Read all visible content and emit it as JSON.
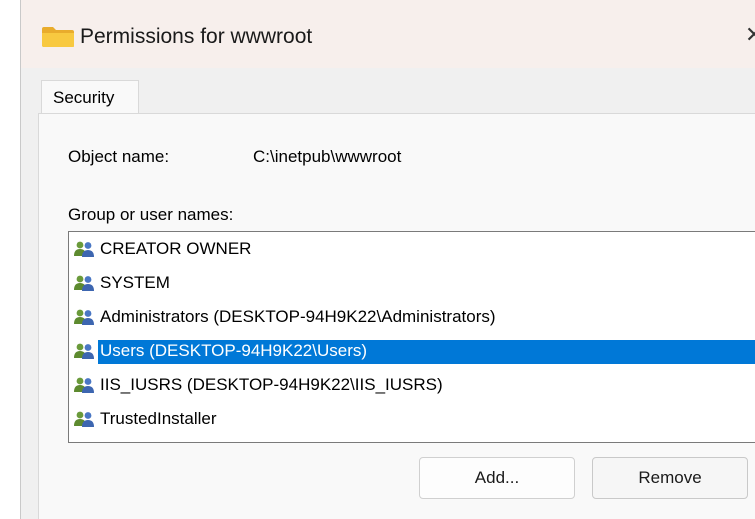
{
  "window": {
    "title": "Permissions for wwwroot",
    "close_glyph": "✕"
  },
  "tabs": [
    {
      "label": "Security",
      "active": true
    }
  ],
  "object": {
    "label": "Object name:",
    "value": "C:\\inetpub\\wwwroot"
  },
  "groups": {
    "label": "Group or user names:",
    "items": [
      {
        "name": "CREATOR OWNER",
        "selected": false,
        "icon": "users-icon"
      },
      {
        "name": "SYSTEM",
        "selected": false,
        "icon": "users-icon"
      },
      {
        "name": "Administrators (DESKTOP-94H9K22\\Administrators)",
        "selected": false,
        "icon": "users-icon"
      },
      {
        "name": "Users (DESKTOP-94H9K22\\Users)",
        "selected": true,
        "icon": "users-icon"
      },
      {
        "name": "IIS_IUSRS (DESKTOP-94H9K22\\IIS_IUSRS)",
        "selected": false,
        "icon": "users-icon"
      },
      {
        "name": "TrustedInstaller",
        "selected": false,
        "icon": "users-icon"
      }
    ]
  },
  "buttons": {
    "add": "Add...",
    "remove": "Remove"
  },
  "colors": {
    "selection": "#0078d7",
    "titlebar": "#f7efec",
    "folder": "#f6c444"
  }
}
